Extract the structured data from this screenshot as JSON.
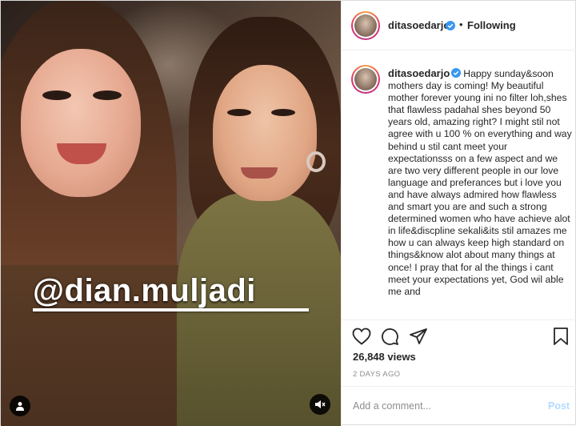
{
  "post": {
    "username": "ditasoedarjo",
    "follow_status": "Following",
    "dot": "•",
    "caption": "Happy sunday&soon mothers day is coming! My beautiful mother forever young ini no filter loh,shes that flawless padahal shes beyond 50 years old, amazing right? I might stil not agree with u 100 % on everything and way behind u stil cant meet your expectationsss on a few aspect and we are two very different people in our love language and preferances but i love you and have always admired how flawless and smart you are and such a strong determined women who have achieve alot in life&discpline sekali&its stil amazes me how u can always keep high standard on things&know alot about many things at once! I pray that for al the things i cant meet your expectations yet, God wil able me and",
    "views": "26,848 views",
    "date": "2 DAYS AGO"
  },
  "media": {
    "mention_sticker": "@dian.muljadi"
  },
  "comment": {
    "placeholder": "Add a comment...",
    "post_label": "Post"
  },
  "icons": {
    "verified": "verified-badge-icon",
    "like": "heart-icon",
    "comment": "comment-bubble-icon",
    "share": "paper-plane-icon",
    "save": "bookmark-icon",
    "tagged_user": "user-icon",
    "sound": "speaker-muted-icon"
  },
  "colors": {
    "verified_blue": "#3897f0",
    "post_button_disabled": "#b3dbff",
    "secondary_text": "#8e8e8e"
  }
}
